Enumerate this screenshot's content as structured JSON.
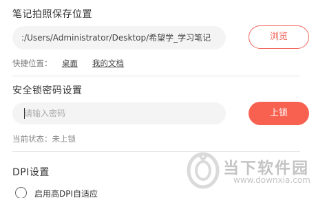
{
  "save_location": {
    "title": "笔记拍照保存位置",
    "path_value": ":/Users/Administrator/Desktop/希望学_学习笔记",
    "browse_label": "浏览",
    "quick_label": "快捷位置：",
    "quick_links": [
      "桌面",
      "我的文档"
    ]
  },
  "security_lock": {
    "title": "安全锁密码设置",
    "password_placeholder": "请输入密码",
    "password_value": "",
    "lock_label": "上锁",
    "status_text": "当前状态：未上锁"
  },
  "dpi": {
    "title": "DPI设置",
    "option_label": "启用高DPI自适应",
    "option_checked": false
  },
  "watermark": {
    "logo_icon": "downxia-logo-icon",
    "title": "当下软件园",
    "url": "www.downxia.com"
  },
  "colors": {
    "accent": "#f86050",
    "accent_outline": "#f0645a",
    "field_bg": "#f4f4f4"
  }
}
